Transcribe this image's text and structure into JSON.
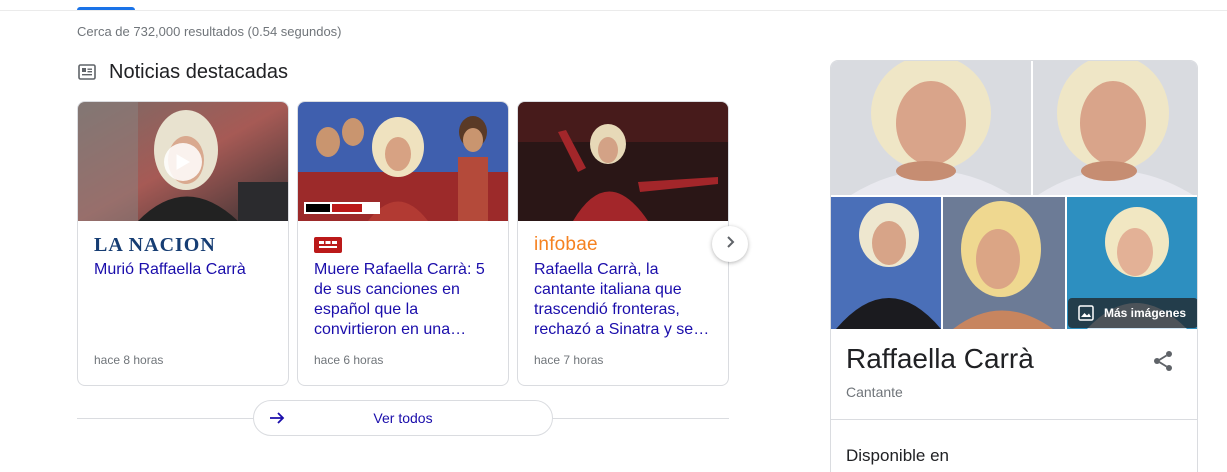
{
  "results": {
    "stats": "Cerca de 732,000 resultados (0.54 segundos)"
  },
  "news": {
    "heading": "Noticias destacadas",
    "cards": [
      {
        "source": "LA NACION",
        "headline": "Murió Raffaella Carrà",
        "age": "hace 8 horas",
        "has_video": true
      },
      {
        "source_icon": "bbc-news-logo",
        "thumb_badge": "BBC NEWS | MUNDO",
        "headline": "Muere Rafaella Carrà: 5 de sus canciones en español que la convirtieron en una…",
        "age": "hace 6 horas"
      },
      {
        "source": "infobae",
        "headline": "Rafaella Carrà, la cantante italiana que trascendió fronteras, rechazó a Sinatra y se…",
        "age": "hace 7 horas"
      }
    ],
    "see_all": "Ver todos"
  },
  "knowledge_panel": {
    "title": "Raffaella Carrà",
    "subtitle": "Cantante",
    "more_images": "Más imágenes",
    "section_heading": "Disponible en"
  },
  "colors": {
    "link": "#1a0dab",
    "secondary_text": "#70757a",
    "border": "#dadce0",
    "accent": "#1a73e8",
    "infobae": "#f58221",
    "lanacion": "#163d73",
    "bbc": "#bb1919"
  },
  "icons": [
    "newspaper-icon",
    "play-icon",
    "chevron-right-icon",
    "arrow-right-icon",
    "image-icon",
    "share-icon"
  ]
}
